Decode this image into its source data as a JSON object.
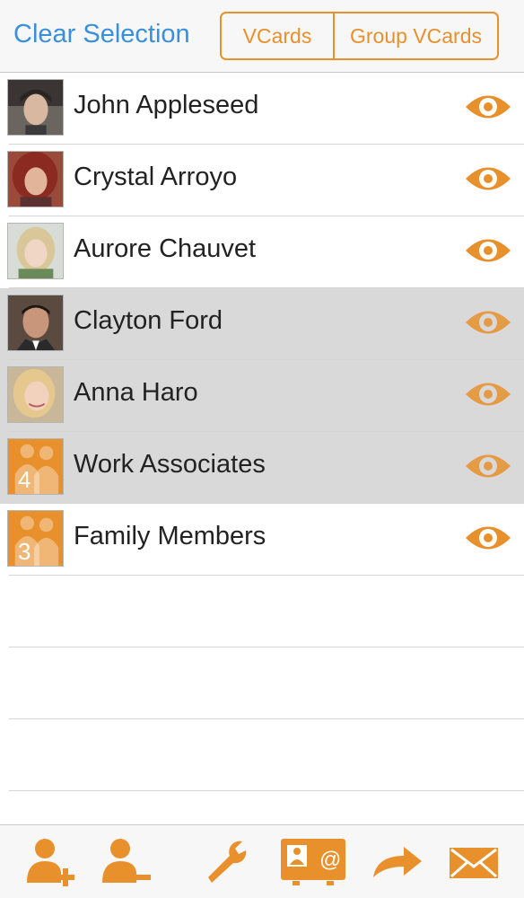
{
  "header": {
    "clear_selection_label": "Clear Selection",
    "tabs": [
      {
        "label": "VCards"
      },
      {
        "label": "Group VCards"
      }
    ]
  },
  "contacts": [
    {
      "name": "John Appleseed",
      "selected": false,
      "avatar_type": "photo"
    },
    {
      "name": "Crystal Arroyo",
      "selected": false,
      "avatar_type": "photo"
    },
    {
      "name": "Aurore Chauvet",
      "selected": false,
      "avatar_type": "photo"
    },
    {
      "name": "Clayton Ford",
      "selected": true,
      "avatar_type": "photo"
    },
    {
      "name": "Anna Haro",
      "selected": true,
      "avatar_type": "photo"
    },
    {
      "name": "Work Associates",
      "selected": true,
      "avatar_type": "group",
      "group_count": "4"
    },
    {
      "name": "Family Members",
      "selected": false,
      "avatar_type": "group",
      "group_count": "3"
    }
  ],
  "toolbar": {
    "icons": [
      "add-contact-icon",
      "remove-contact-icon",
      "wrench-icon",
      "contact-card-email-icon",
      "forward-arrow-icon",
      "envelope-icon"
    ]
  },
  "colors": {
    "accent": "#e8902c",
    "link_blue": "#3a8fdc",
    "selected_row": "#d9d9d9"
  }
}
